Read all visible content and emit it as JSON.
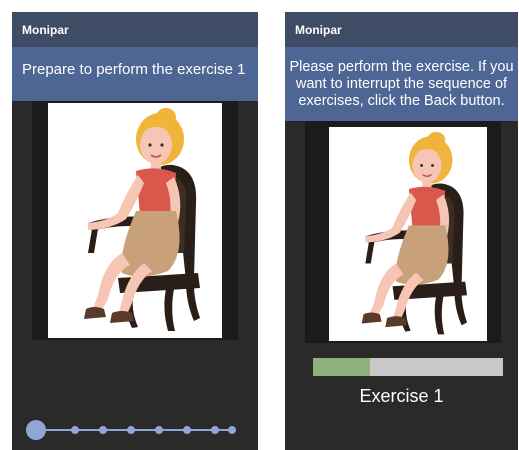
{
  "left_screen": {
    "app_title": "Monipar",
    "banner_text": "Prepare to perform the exercise 1",
    "stepper": {
      "total_steps": 8,
      "current_step": 1
    }
  },
  "right_screen": {
    "app_title": "Monipar",
    "banner_lines": [
      "Please perform the exercise. If you",
      "want to interrupt the sequence of",
      "exercises, click the Back button."
    ],
    "progress_fraction": 0.3,
    "exercise_label": "Exercise 1"
  },
  "colors": {
    "app_bar": "#3e4c66",
    "banner": "#4d6694",
    "progress_fill": "#8db37a",
    "stepper": "#8fa6d6"
  }
}
